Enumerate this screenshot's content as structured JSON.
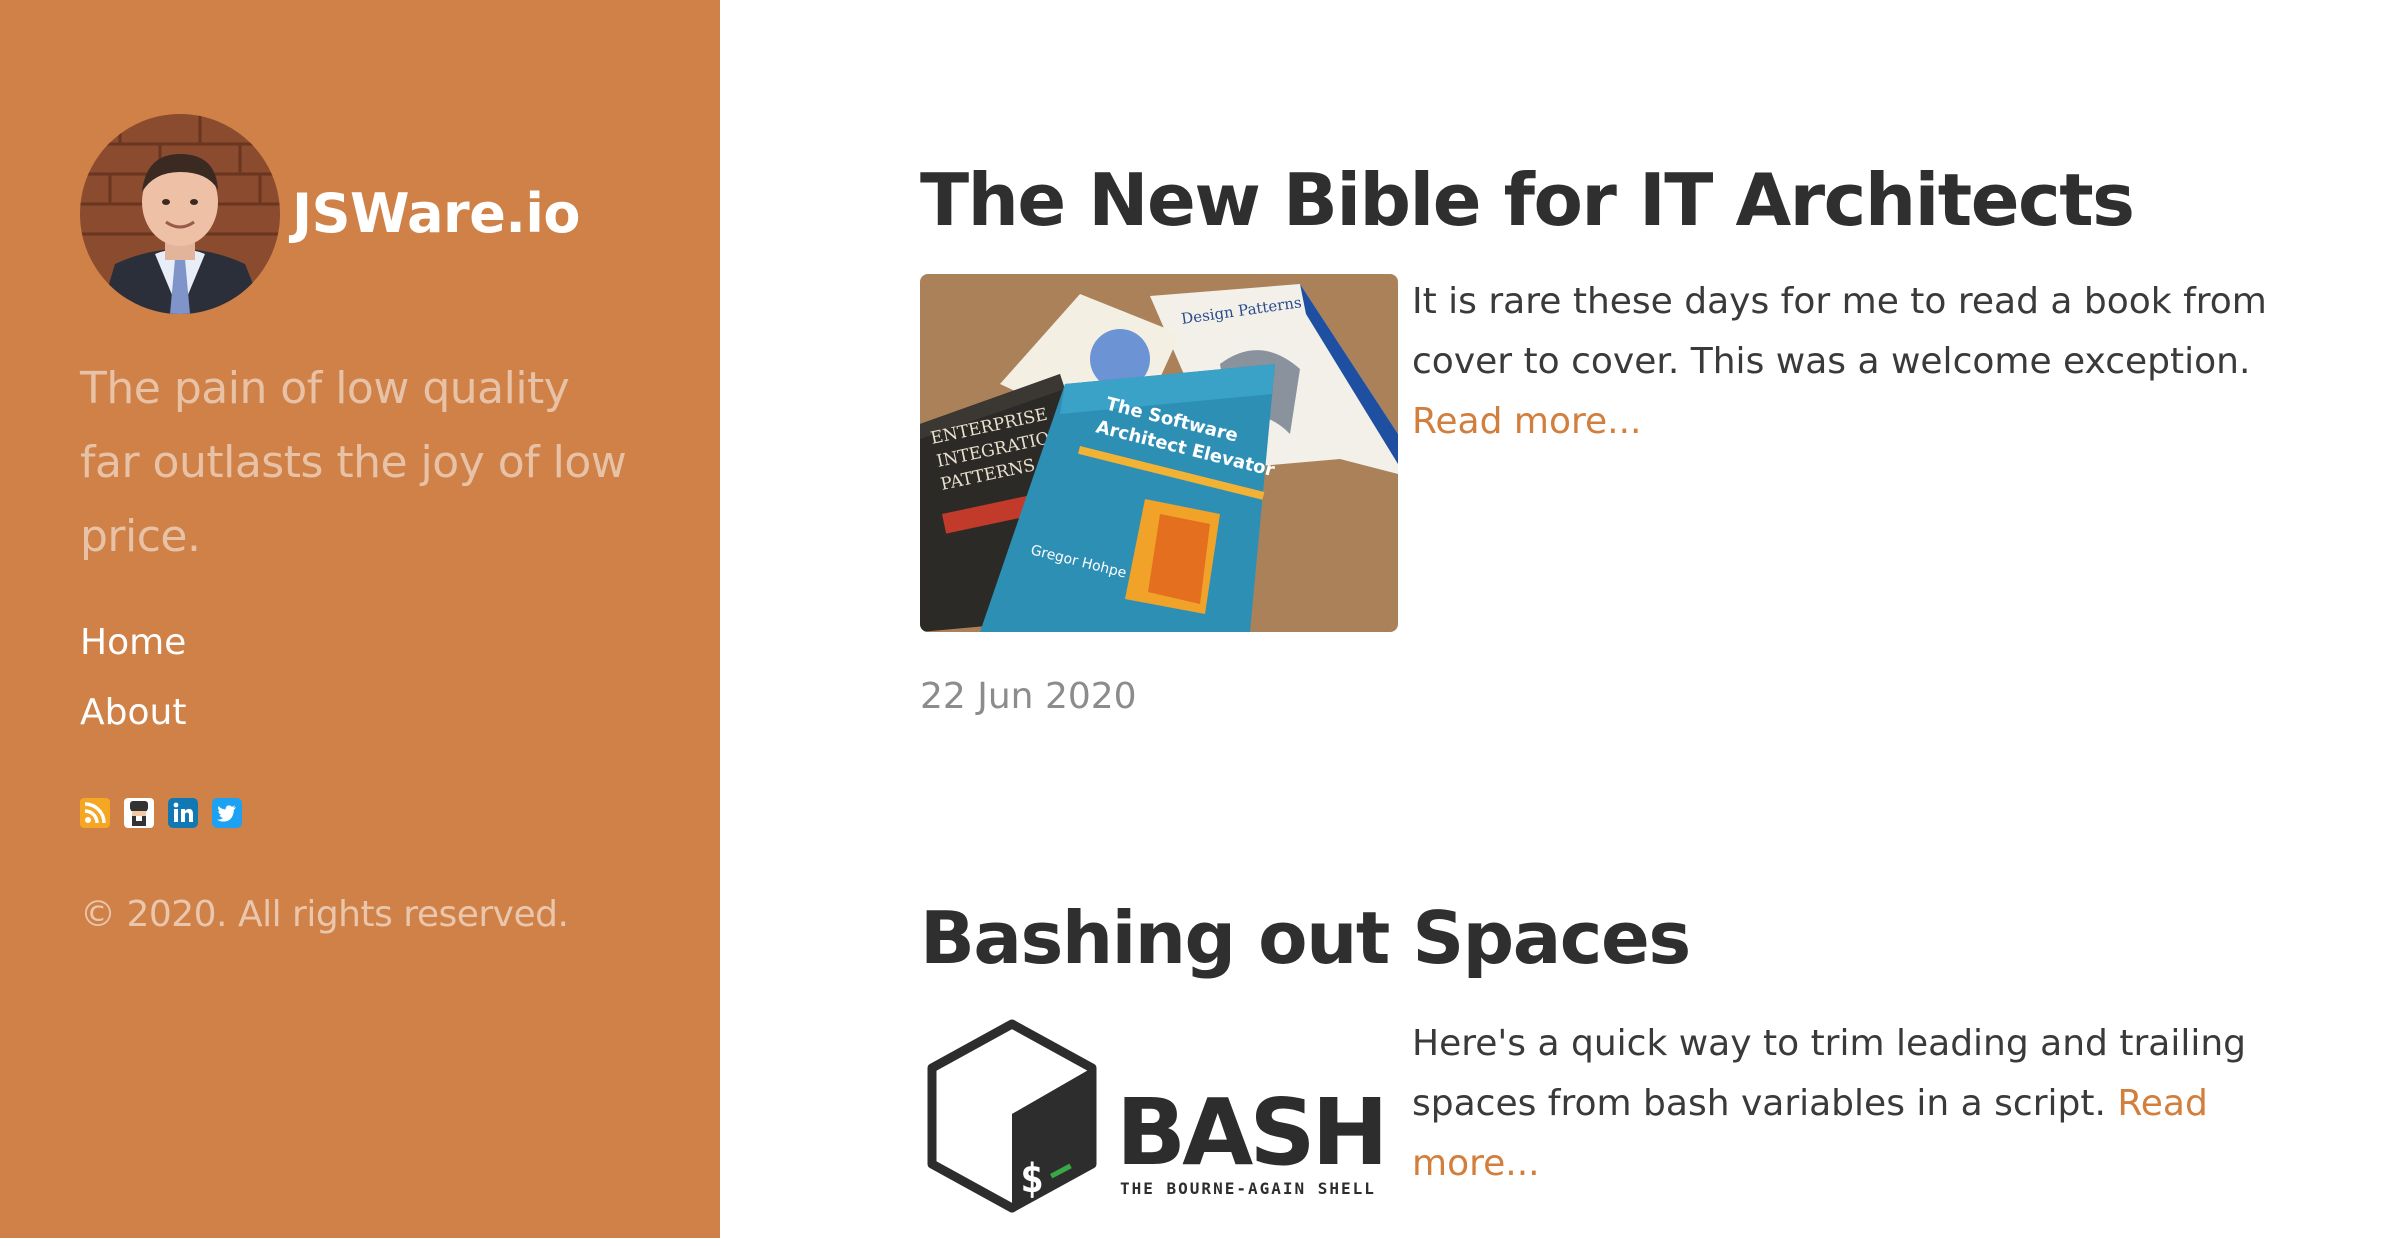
{
  "site": {
    "title": "JSWare.io",
    "tagline": "The pain of low quality far outlasts the joy of low price.",
    "copyright": "© 2020. All rights reserved.",
    "accent_color": "#cf8147",
    "link_color": "#d27e3c"
  },
  "nav": {
    "items": [
      {
        "label": "Home"
      },
      {
        "label": "About"
      }
    ]
  },
  "social": [
    {
      "name": "rss-icon",
      "color": "#f5a623"
    },
    {
      "name": "github-icon",
      "color": "#333333"
    },
    {
      "name": "linkedin-icon",
      "color": "#1178b3"
    },
    {
      "name": "twitter-icon",
      "color": "#1da1f2"
    }
  ],
  "posts": [
    {
      "title": "The New Bible for IT Architects",
      "excerpt": "It is rare these days for me to read a book from cover to cover. This was a welcome exception.",
      "read_more": "Read more...",
      "date": "22 Jun 2020",
      "thumbnail": {
        "alt": "books-photo",
        "book_labels": [
          "Design Patterns",
          "The Software Architect Elevator",
          "Gregor Hohpe",
          "Enterprise Integration Patterns"
        ]
      }
    },
    {
      "title": "Bashing out Spaces",
      "excerpt": "Here's a quick way to trim leading and trailing spaces from bash variables in a script.",
      "read_more": "Read more...",
      "thumbnail": {
        "alt": "bash-logo",
        "logo_text": "BASH",
        "logo_subtext": "THE BOURNE-AGAIN SHELL",
        "prompt": "$_"
      }
    }
  ]
}
